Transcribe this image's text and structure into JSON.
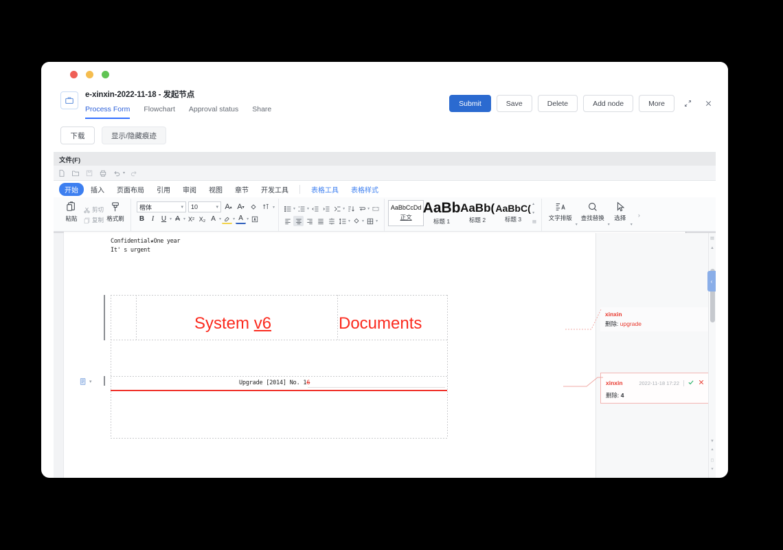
{
  "app_header": {
    "doc_icon": "briefcase-icon",
    "title": "e-xinxin-2022-11-18 - 发起节点",
    "tabs": [
      {
        "label": "Process Form",
        "active": true
      },
      {
        "label": "Flowchart",
        "active": false
      },
      {
        "label": "Approval status",
        "active": false
      },
      {
        "label": "Share",
        "active": false
      }
    ],
    "actions": [
      {
        "label": "Submit",
        "primary": true
      },
      {
        "label": "Save",
        "primary": false
      },
      {
        "label": "Delete",
        "primary": false
      },
      {
        "label": "Add node",
        "primary": false
      },
      {
        "label": "More",
        "primary": false
      }
    ],
    "expand_icon": "expand-diagonal-icon",
    "close_icon": "close-icon",
    "accent_color": "#2b6ad0"
  },
  "subbar": {
    "download_label": "下载",
    "toggle_trace_label": "显示/隐藏痕迹"
  },
  "office": {
    "menubar": {
      "file_label": "文件(F)"
    },
    "quick_access": [
      "new-document-icon",
      "open-folder-icon",
      "save-icon",
      "print-icon",
      "undo-icon",
      "redo-icon"
    ],
    "ribbon_tabs": [
      {
        "label": "开始",
        "active": true,
        "context": false
      },
      {
        "label": "插入",
        "active": false,
        "context": false
      },
      {
        "label": "页面布局",
        "active": false,
        "context": false
      },
      {
        "label": "引用",
        "active": false,
        "context": false
      },
      {
        "label": "审阅",
        "active": false,
        "context": false
      },
      {
        "label": "视图",
        "active": false,
        "context": false
      },
      {
        "label": "章节",
        "active": false,
        "context": false
      },
      {
        "label": "开发工具",
        "active": false,
        "context": false
      },
      {
        "label": "表格工具",
        "active": false,
        "context": true
      },
      {
        "label": "表格样式",
        "active": false,
        "context": true
      }
    ],
    "clipboard": {
      "paste_label": "粘贴",
      "cut_label": "剪切",
      "copy_label": "复制",
      "format_painter_label": "格式刷"
    },
    "font": {
      "family": "楷体",
      "size": "10",
      "bold": "B",
      "italic": "I",
      "underline": "U",
      "grow_font": "A",
      "shrink_font": "A",
      "clear_format": "clear-formatting-icon",
      "pinyin_guide": "pinyin-guide-icon",
      "strikethrough_icon": "font-color-icon",
      "superscript": "X²",
      "subscript": "X₂",
      "char_border": "character-border-icon",
      "highlight_icon": "highlight-color-icon",
      "fontcolor_icon": "font-color-icon"
    },
    "paragraph": {
      "bullets_icon": "bullet-list-icon",
      "numbering_icon": "numbered-list-icon",
      "decrease_indent_icon": "decrease-indent-icon",
      "increase_indent_icon": "increase-indent-icon",
      "multilevel_icon": "multilevel-list-icon",
      "sort_icon": "sort-icon",
      "line_break_icon": "line-break-icon",
      "show_marks_icon": "show-formatting-marks-icon",
      "align_left_icon": "align-left-icon",
      "align_center_icon": "align-center-icon",
      "align_right_icon": "align-right-icon",
      "align_justify_icon": "align-justify-icon",
      "distribute_icon": "distribute-text-icon",
      "line_spacing_icon": "line-spacing-icon",
      "shading_icon": "shading-icon",
      "borders_icon": "borders-icon",
      "center_active": true
    },
    "styles": [
      {
        "sample": "AaBbCcDd",
        "name": "正文",
        "selected": true,
        "size": 9
      },
      {
        "sample": "AaBb",
        "name": "标题 1",
        "selected": false,
        "size": 21
      },
      {
        "sample": "AaBb(",
        "name": "标题 2",
        "selected": false,
        "size": 17
      },
      {
        "sample": "AaBbC(",
        "name": "标题 3",
        "selected": false,
        "size": 14
      }
    ],
    "right_tools": [
      {
        "label": "文字排版",
        "icon": "text-layout-icon"
      },
      {
        "label": "查找替换",
        "icon": "search-icon"
      },
      {
        "label": "选择",
        "icon": "select-cursor-icon"
      }
    ],
    "ribbon_more_icon": "chevron-right-icon"
  },
  "document": {
    "header_lines": [
      "Confidential★One year",
      "It' s urgent"
    ],
    "table_cells": [
      {
        "text": "System ",
        "tracked": "v6"
      },
      {
        "text": "Documents",
        "tracked": ""
      }
    ],
    "upgrade_line": {
      "prefix": "Upgrade [2014] No. 1",
      "deleted": "6"
    },
    "paste_options_icon": "paste-options-icon"
  },
  "comments": [
    {
      "author": "xinxin",
      "time": "",
      "label": "删除:",
      "value": "upgrade",
      "boxed": false,
      "accept_icon": "",
      "reject_icon": ""
    },
    {
      "author": "xinxin",
      "time": "2022-11-18 17:22",
      "label": "删除:",
      "value": "4",
      "boxed": true,
      "accept_icon": "check-icon",
      "reject_icon": "close-icon"
    }
  ],
  "scrollbar": {
    "up_icon": "scroll-up-icon",
    "prev_page_icon": "previous-page-icon",
    "select_browse_icon": "select-browse-object-icon",
    "next_page_icon": "next-page-icon",
    "collapse_tab_icon": "chevron-left-icon"
  }
}
